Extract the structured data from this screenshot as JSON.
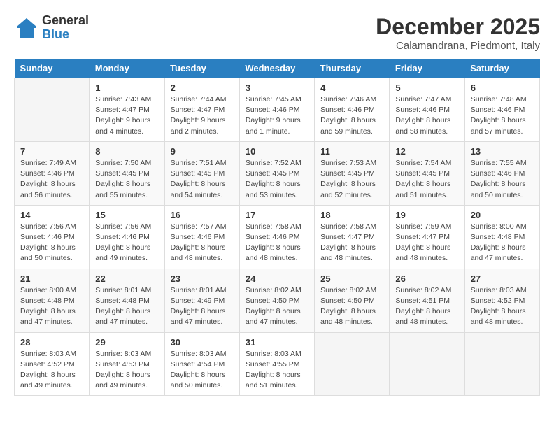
{
  "logo": {
    "general": "General",
    "blue": "Blue"
  },
  "title": "December 2025",
  "location": "Calamandrana, Piedmont, Italy",
  "days_of_week": [
    "Sunday",
    "Monday",
    "Tuesday",
    "Wednesday",
    "Thursday",
    "Friday",
    "Saturday"
  ],
  "weeks": [
    [
      {
        "day": "",
        "info": ""
      },
      {
        "day": "1",
        "info": "Sunrise: 7:43 AM\nSunset: 4:47 PM\nDaylight: 9 hours\nand 4 minutes."
      },
      {
        "day": "2",
        "info": "Sunrise: 7:44 AM\nSunset: 4:47 PM\nDaylight: 9 hours\nand 2 minutes."
      },
      {
        "day": "3",
        "info": "Sunrise: 7:45 AM\nSunset: 4:46 PM\nDaylight: 9 hours\nand 1 minute."
      },
      {
        "day": "4",
        "info": "Sunrise: 7:46 AM\nSunset: 4:46 PM\nDaylight: 8 hours\nand 59 minutes."
      },
      {
        "day": "5",
        "info": "Sunrise: 7:47 AM\nSunset: 4:46 PM\nDaylight: 8 hours\nand 58 minutes."
      },
      {
        "day": "6",
        "info": "Sunrise: 7:48 AM\nSunset: 4:46 PM\nDaylight: 8 hours\nand 57 minutes."
      }
    ],
    [
      {
        "day": "7",
        "info": "Sunrise: 7:49 AM\nSunset: 4:46 PM\nDaylight: 8 hours\nand 56 minutes."
      },
      {
        "day": "8",
        "info": "Sunrise: 7:50 AM\nSunset: 4:45 PM\nDaylight: 8 hours\nand 55 minutes."
      },
      {
        "day": "9",
        "info": "Sunrise: 7:51 AM\nSunset: 4:45 PM\nDaylight: 8 hours\nand 54 minutes."
      },
      {
        "day": "10",
        "info": "Sunrise: 7:52 AM\nSunset: 4:45 PM\nDaylight: 8 hours\nand 53 minutes."
      },
      {
        "day": "11",
        "info": "Sunrise: 7:53 AM\nSunset: 4:45 PM\nDaylight: 8 hours\nand 52 minutes."
      },
      {
        "day": "12",
        "info": "Sunrise: 7:54 AM\nSunset: 4:45 PM\nDaylight: 8 hours\nand 51 minutes."
      },
      {
        "day": "13",
        "info": "Sunrise: 7:55 AM\nSunset: 4:46 PM\nDaylight: 8 hours\nand 50 minutes."
      }
    ],
    [
      {
        "day": "14",
        "info": "Sunrise: 7:56 AM\nSunset: 4:46 PM\nDaylight: 8 hours\nand 50 minutes."
      },
      {
        "day": "15",
        "info": "Sunrise: 7:56 AM\nSunset: 4:46 PM\nDaylight: 8 hours\nand 49 minutes."
      },
      {
        "day": "16",
        "info": "Sunrise: 7:57 AM\nSunset: 4:46 PM\nDaylight: 8 hours\nand 48 minutes."
      },
      {
        "day": "17",
        "info": "Sunrise: 7:58 AM\nSunset: 4:46 PM\nDaylight: 8 hours\nand 48 minutes."
      },
      {
        "day": "18",
        "info": "Sunrise: 7:58 AM\nSunset: 4:47 PM\nDaylight: 8 hours\nand 48 minutes."
      },
      {
        "day": "19",
        "info": "Sunrise: 7:59 AM\nSunset: 4:47 PM\nDaylight: 8 hours\nand 48 minutes."
      },
      {
        "day": "20",
        "info": "Sunrise: 8:00 AM\nSunset: 4:48 PM\nDaylight: 8 hours\nand 47 minutes."
      }
    ],
    [
      {
        "day": "21",
        "info": "Sunrise: 8:00 AM\nSunset: 4:48 PM\nDaylight: 8 hours\nand 47 minutes."
      },
      {
        "day": "22",
        "info": "Sunrise: 8:01 AM\nSunset: 4:48 PM\nDaylight: 8 hours\nand 47 minutes."
      },
      {
        "day": "23",
        "info": "Sunrise: 8:01 AM\nSunset: 4:49 PM\nDaylight: 8 hours\nand 47 minutes."
      },
      {
        "day": "24",
        "info": "Sunrise: 8:02 AM\nSunset: 4:50 PM\nDaylight: 8 hours\nand 47 minutes."
      },
      {
        "day": "25",
        "info": "Sunrise: 8:02 AM\nSunset: 4:50 PM\nDaylight: 8 hours\nand 48 minutes."
      },
      {
        "day": "26",
        "info": "Sunrise: 8:02 AM\nSunset: 4:51 PM\nDaylight: 8 hours\nand 48 minutes."
      },
      {
        "day": "27",
        "info": "Sunrise: 8:03 AM\nSunset: 4:52 PM\nDaylight: 8 hours\nand 48 minutes."
      }
    ],
    [
      {
        "day": "28",
        "info": "Sunrise: 8:03 AM\nSunset: 4:52 PM\nDaylight: 8 hours\nand 49 minutes."
      },
      {
        "day": "29",
        "info": "Sunrise: 8:03 AM\nSunset: 4:53 PM\nDaylight: 8 hours\nand 49 minutes."
      },
      {
        "day": "30",
        "info": "Sunrise: 8:03 AM\nSunset: 4:54 PM\nDaylight: 8 hours\nand 50 minutes."
      },
      {
        "day": "31",
        "info": "Sunrise: 8:03 AM\nSunset: 4:55 PM\nDaylight: 8 hours\nand 51 minutes."
      },
      {
        "day": "",
        "info": ""
      },
      {
        "day": "",
        "info": ""
      },
      {
        "day": "",
        "info": ""
      }
    ]
  ]
}
